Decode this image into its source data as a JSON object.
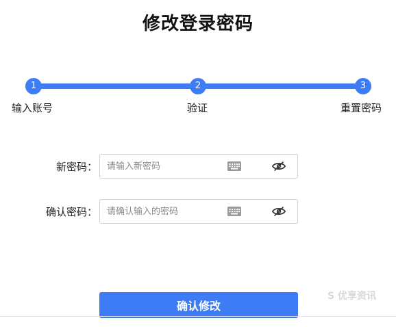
{
  "page": {
    "title": "修改登录密码"
  },
  "colors": {
    "accent": "#3d7cf5",
    "border": "#cfcfcf",
    "icon": "#9a9a9a"
  },
  "steps": [
    {
      "number": "1",
      "label": "输入账号"
    },
    {
      "number": "2",
      "label": "验证"
    },
    {
      "number": "3",
      "label": "重置密码"
    }
  ],
  "form": {
    "new_password": {
      "label": "新密码：",
      "value": "",
      "placeholder": "请输入新密码",
      "keyboard_icon": "keyboard-icon",
      "visibility_icon": "eye-off-icon"
    },
    "confirm_password": {
      "label": "确认密码：",
      "value": "",
      "placeholder": "请确认输入的密码",
      "keyboard_icon": "keyboard-icon",
      "visibility_icon": "eye-off-icon"
    },
    "submit_label": "确认修改"
  },
  "watermark": {
    "text": "S 优享资讯"
  }
}
